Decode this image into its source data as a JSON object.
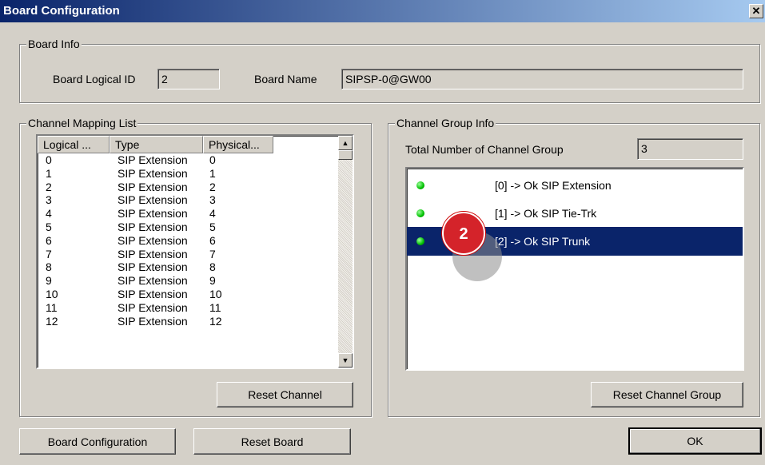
{
  "window": {
    "title": "Board Configuration",
    "close_glyph": "✕"
  },
  "board_info": {
    "legend": "Board Info",
    "logical_id_label": "Board Logical ID",
    "logical_id_value": "2",
    "name_label": "Board Name",
    "name_value": "SIPSP-0@GW00"
  },
  "channel_mapping": {
    "legend": "Channel Mapping List",
    "columns": [
      "Logical ...",
      "Type",
      "Physical..."
    ],
    "rows": [
      [
        "0",
        "SIP Extension",
        "0"
      ],
      [
        "1",
        "SIP Extension",
        "1"
      ],
      [
        "2",
        "SIP Extension",
        "2"
      ],
      [
        "3",
        "SIP Extension",
        "3"
      ],
      [
        "4",
        "SIP Extension",
        "4"
      ],
      [
        "5",
        "SIP Extension",
        "5"
      ],
      [
        "6",
        "SIP Extension",
        "6"
      ],
      [
        "7",
        "SIP Extension",
        "7"
      ],
      [
        "8",
        "SIP Extension",
        "8"
      ],
      [
        "9",
        "SIP Extension",
        "9"
      ],
      [
        "10",
        "SIP Extension",
        "10"
      ],
      [
        "11",
        "SIP Extension",
        "11"
      ],
      [
        "12",
        "SIP Extension",
        "12"
      ]
    ],
    "scroll_up_glyph": "▲",
    "scroll_down_glyph": "▼",
    "reset_channel_label": "Reset Channel"
  },
  "channel_group": {
    "legend": "Channel Group Info",
    "total_label": "Total Number of Channel Group",
    "total_value": "3",
    "items": [
      {
        "text": "[0] -> Ok  SIP Extension",
        "status_icon": "green-status-dot",
        "selected": false
      },
      {
        "text": "[1] -> Ok  SIP Tie-Trk",
        "status_icon": "green-status-dot",
        "selected": false
      },
      {
        "text": "[2] -> Ok  SIP Trunk",
        "status_icon": "green-status-dot",
        "selected": true
      }
    ],
    "reset_group_label": "Reset Channel Group"
  },
  "footer": {
    "board_config_label": "Board Configuration",
    "reset_board_label": "Reset Board",
    "ok_label": "OK"
  },
  "callout": {
    "number": "2",
    "color": "#d4232a"
  },
  "colors": {
    "selection": "#0a246a",
    "dialog_bg": "#d4d0c8",
    "status_ok": "#00c000"
  }
}
